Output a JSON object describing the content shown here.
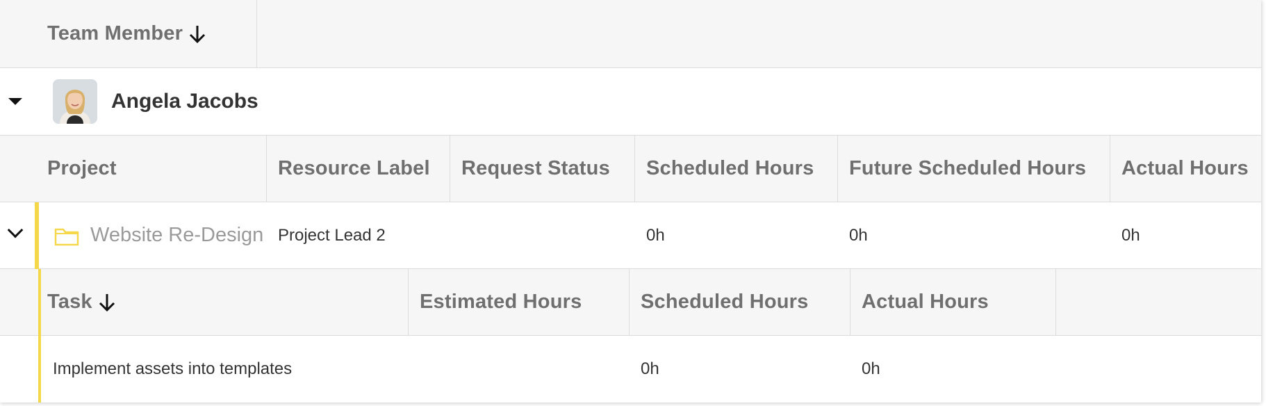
{
  "team_header": {
    "label": "Team Member"
  },
  "person": {
    "name": "Angela Jacobs"
  },
  "project_columns": [
    "Project",
    "Resource Label",
    "Request Status",
    "Scheduled Hours",
    "Future Scheduled Hours",
    "Actual Hours"
  ],
  "project_row": {
    "name": "Website Re-Design",
    "resource_label": "Project Lead 2",
    "request_status": "",
    "scheduled_hours": "0h",
    "future_scheduled_hours": "0h",
    "actual_hours": "0h"
  },
  "task_columns": [
    "Task",
    "Estimated Hours",
    "Scheduled Hours",
    "Actual Hours"
  ],
  "task_row": {
    "name": "Implement assets into templates",
    "estimated_hours": "",
    "scheduled_hours": "0h",
    "actual_hours": "0h"
  },
  "colors": {
    "accent": "#f4d84a",
    "header_bg": "#f6f6f6",
    "border": "#dcdcdc"
  },
  "icons": {
    "sort": "arrow-down-icon",
    "expand": "caret-down-icon",
    "collapse": "chevron-down-icon",
    "project": "folder-icon"
  }
}
